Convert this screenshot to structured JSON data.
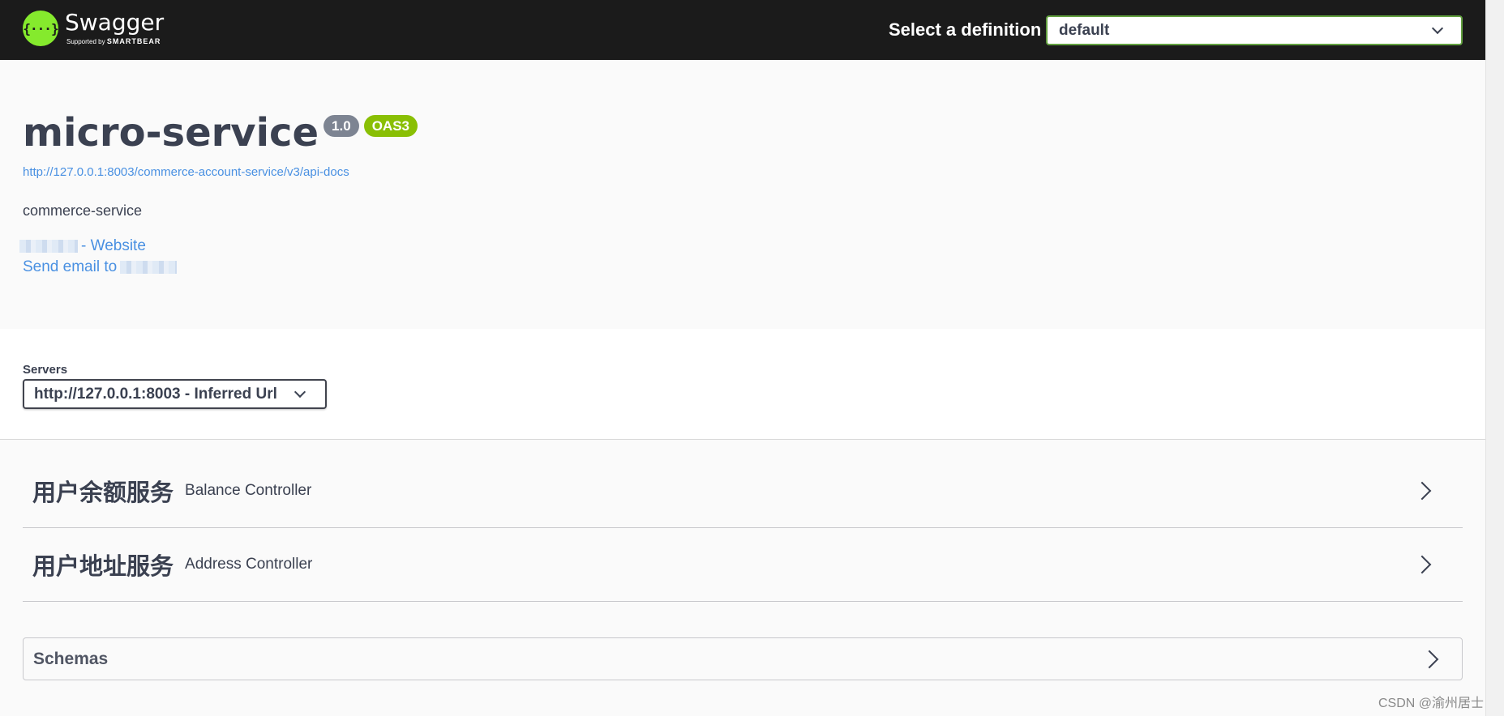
{
  "header": {
    "logo_name": "Swagger",
    "logo_supported": "Supported by",
    "logo_brand": "SMARTBEAR",
    "logo_glyph": "{···}",
    "definition_label": "Select a definition",
    "definition_value": "default"
  },
  "info": {
    "title": "micro-service",
    "version_badge": "1.0",
    "oas_badge": "OAS3",
    "docs_url": "http://127.0.0.1:8003/commerce-account-service/v3/api-docs",
    "description": "commerce-service",
    "website_link": "- Website",
    "email_link": "Send email to"
  },
  "servers": {
    "label": "Servers",
    "selected": "http://127.0.0.1:8003 - Inferred Url"
  },
  "tags": [
    {
      "name": "用户余额服务",
      "description": "Balance Controller"
    },
    {
      "name": "用户地址服务",
      "description": "Address Controller"
    }
  ],
  "schemas": {
    "label": "Schemas"
  },
  "watermark": "CSDN @渝州居士",
  "colors": {
    "topbar": "#1b1b1b",
    "logo_green": "#85ea2d",
    "link_blue": "#4990e2",
    "badge_gray": "#7d8492",
    "badge_green": "#89bf04",
    "text_dark": "#3b4151"
  }
}
